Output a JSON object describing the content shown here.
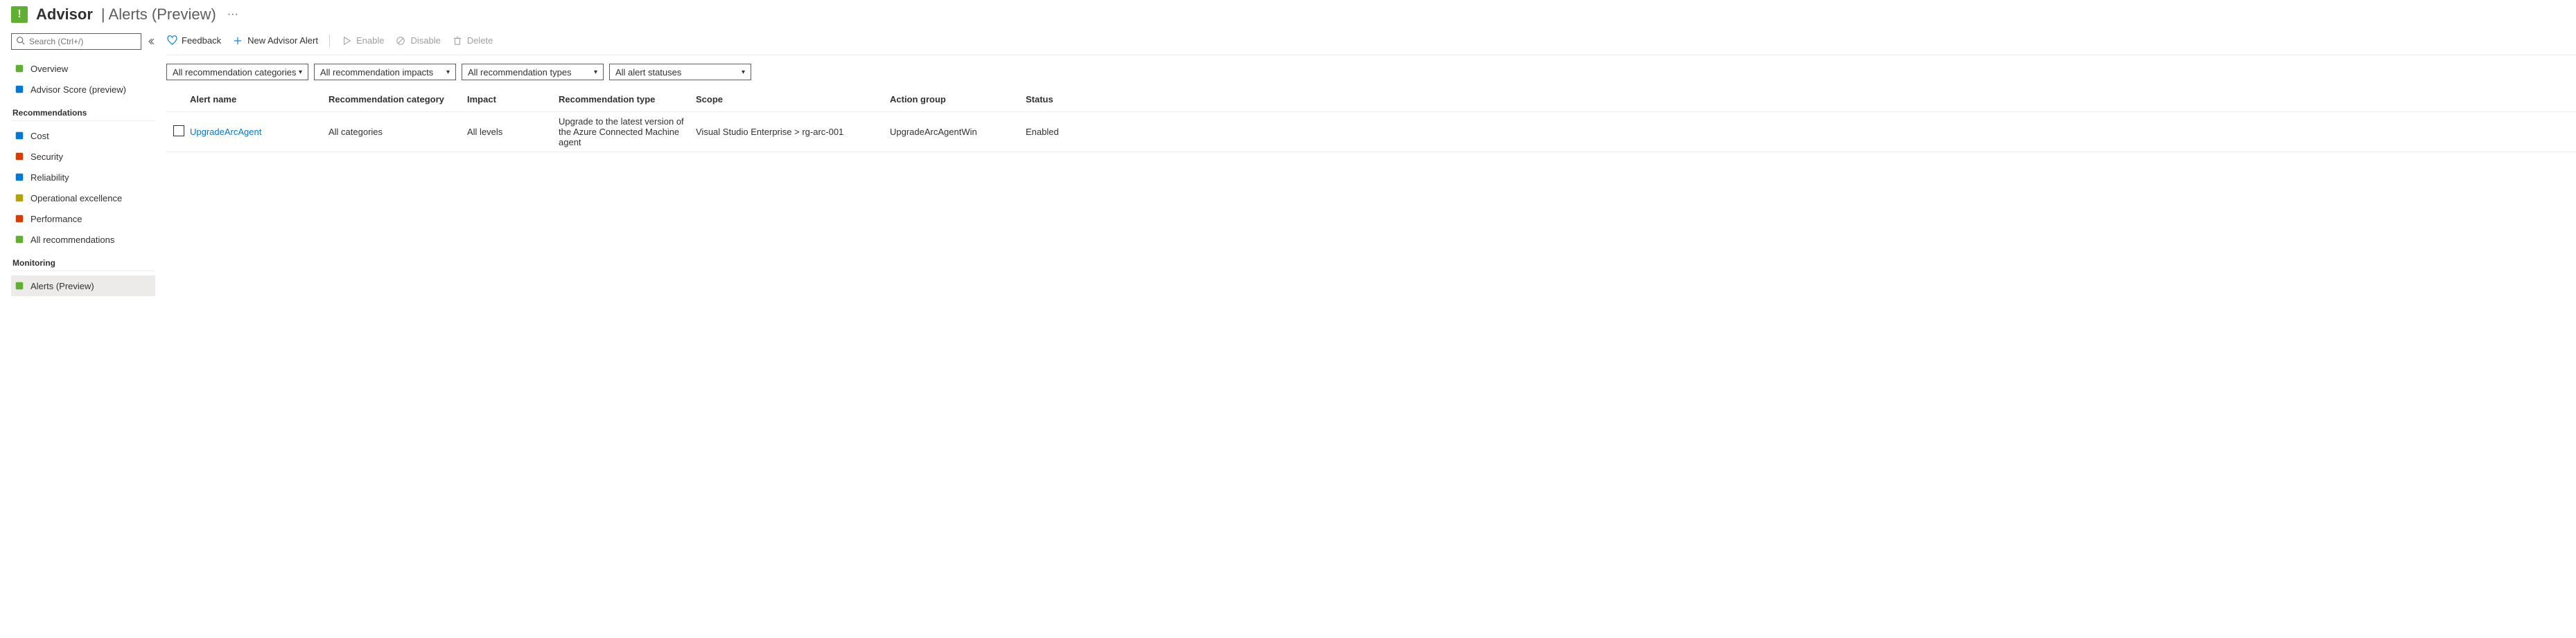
{
  "header": {
    "service": "Advisor",
    "page": "Alerts (Preview)"
  },
  "sidebar": {
    "search_placeholder": "Search (Ctrl+/)",
    "top": [
      {
        "label": "Overview",
        "icon_color": "#5fb030"
      },
      {
        "label": "Advisor Score (preview)",
        "icon_color": "#0078d4"
      }
    ],
    "sections": [
      {
        "title": "Recommendations",
        "items": [
          {
            "label": "Cost",
            "icon_color": "#0078d4"
          },
          {
            "label": "Security",
            "icon_color": "#da3b01"
          },
          {
            "label": "Reliability",
            "icon_color": "#0078d4"
          },
          {
            "label": "Operational excellence",
            "icon_color": "#b4a00b"
          },
          {
            "label": "Performance",
            "icon_color": "#da3b01"
          },
          {
            "label": "All recommendations",
            "icon_color": "#5fb030"
          }
        ]
      },
      {
        "title": "Monitoring",
        "items": [
          {
            "label": "Alerts (Preview)",
            "icon_color": "#5fb030",
            "active": true
          }
        ]
      }
    ]
  },
  "toolbar": {
    "feedback": "Feedback",
    "new_alert": "New Advisor Alert",
    "enable": "Enable",
    "disable": "Disable",
    "delete": "Delete"
  },
  "filters": {
    "category": "All recommendation categories",
    "impact": "All recommendation impacts",
    "type": "All recommendation types",
    "status": "All alert statuses"
  },
  "table": {
    "columns": {
      "name": "Alert name",
      "cat": "Recommendation category",
      "impact": "Impact",
      "type": "Recommendation type",
      "scope": "Scope",
      "action": "Action group",
      "status": "Status"
    },
    "rows": [
      {
        "name": "UpgradeArcAgent",
        "cat": "All categories",
        "impact": "All levels",
        "type": "Upgrade to the latest version of the Azure Connected Machine agent",
        "scope": "Visual Studio Enterprise > rg-arc-001",
        "action": "UpgradeArcAgentWin",
        "status": "Enabled"
      }
    ]
  }
}
